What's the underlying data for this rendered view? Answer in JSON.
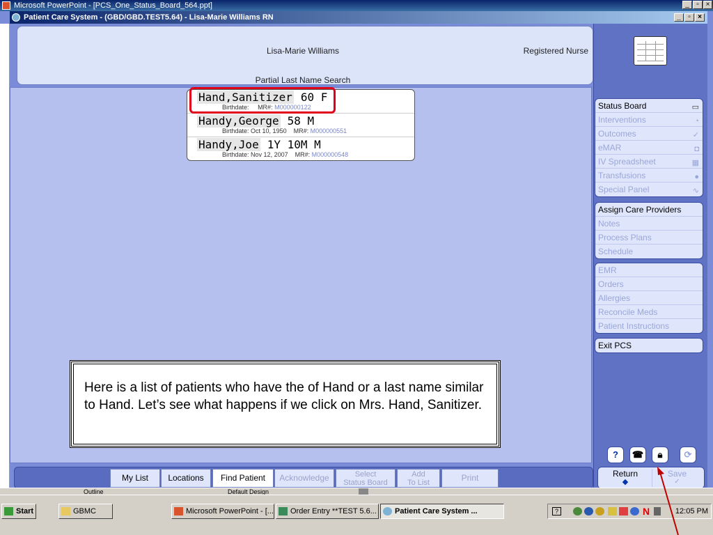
{
  "window": {
    "outer_title": "Microsoft PowerPoint - [PCS_One_Status_Board_564.ppt]",
    "app_title": "Patient Care System - (GBD/GBD.TEST5.64) - Lisa-Marie Williams RN"
  },
  "header": {
    "user_name": "Lisa-Marie Williams",
    "user_role": "Registered Nurse",
    "search_title": "Partial Last Name Search"
  },
  "results": [
    {
      "name": "Hand,Sanitizer",
      "agesex": "60 F",
      "birthdate_label": "Birthdate:",
      "birthdate": "",
      "mr_label": "MR#:",
      "mr": "M000000122"
    },
    {
      "name": "Handy,George",
      "agesex": "58 M",
      "birthdate_label": "Birthdate:",
      "birthdate": "Oct 10, 1950",
      "mr_label": "MR#:",
      "mr": "M000000551"
    },
    {
      "name": "Handy,Joe",
      "agesex": "1Y 10M M",
      "birthdate_label": "Birthdate:",
      "birthdate": "Nov 12, 2007",
      "mr_label": "MR#:",
      "mr": "M000000548"
    }
  ],
  "callout": {
    "text": "Here is a list of patients who have the of Hand or a last name similar to Hand. Let’s see what happens if we click on Mrs. Hand, Sanitizer."
  },
  "toolbar": {
    "my_list": "My List",
    "locations": "Locations",
    "find_patient": "Find Patient",
    "acknowledge": "Acknowledge",
    "select_1": "Select",
    "select_2": "Status Board",
    "add_1": "Add",
    "add_2": "To List",
    "print": "Print"
  },
  "menu": {
    "group1": [
      "Status Board",
      "Interventions",
      "Outcomes",
      "eMAR",
      "IV Spreadsheet",
      "Transfusions",
      "Special Panel"
    ],
    "group2": [
      "Assign Care Providers",
      "Notes",
      "Process Plans",
      "Schedule"
    ],
    "group3": [
      "EMR",
      "Orders",
      "Allergies",
      "Reconcile Meds",
      "Patient Instructions"
    ],
    "group4": [
      "Exit PCS"
    ]
  },
  "nav": {
    "return": "Return",
    "save": "Save",
    "help": "?"
  },
  "statusbar": {
    "outline": "Outline",
    "design": "Default Design"
  },
  "taskbar": {
    "start": "Start",
    "items": [
      "GBMC",
      "Microsoft PowerPoint - [...",
      "Order Entry **TEST 5.6...",
      "Patient Care System ..."
    ],
    "clock": "12:05 PM"
  },
  "colors": {
    "background": "#b6c0ee",
    "panel": "#5f72c4",
    "highlight": "#e0001a"
  }
}
